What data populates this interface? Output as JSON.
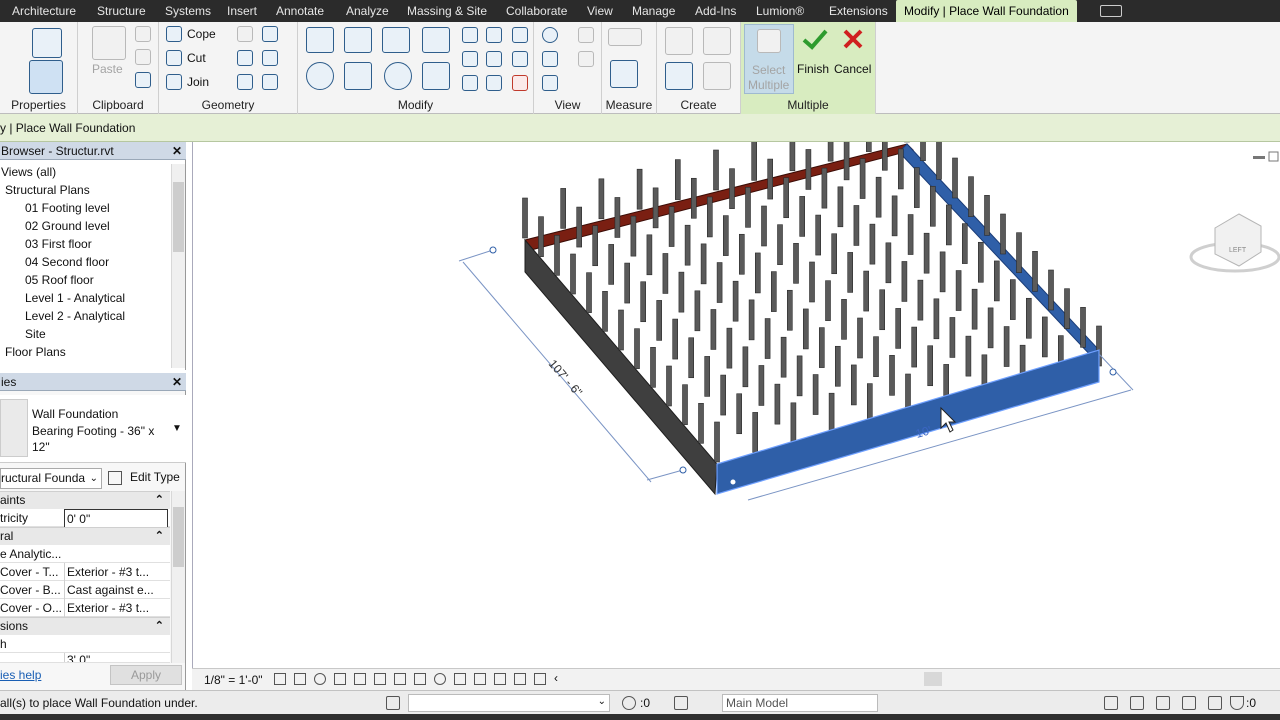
{
  "ribbon_tabs": [
    "Architecture",
    "Structure",
    "Systems",
    "Insert",
    "Annotate",
    "Analyze",
    "Massing & Site",
    "Collaborate",
    "View",
    "Manage",
    "Add-Ins",
    "Lumion®",
    "Extensions",
    "Modify | Place Wall Foundation"
  ],
  "ribbon": {
    "panels": {
      "properties": "Properties",
      "clipboard": "Clipboard",
      "geometry": "Geometry",
      "modify": "Modify",
      "view": "View",
      "measure": "Measure",
      "create": "Create",
      "multiple": "Multiple"
    },
    "paste": "Paste",
    "cope": "Cope",
    "cut": "Cut",
    "join": "Join",
    "select_multiple_1": "Select",
    "select_multiple_2": "Multiple",
    "finish": "Finish",
    "cancel": "Cancel"
  },
  "options_bar": {
    "label": "y | Place Wall Foundation"
  },
  "project_browser": {
    "title": "Browser - Structur.rvt",
    "items": [
      "Views (all)",
      "Structural Plans",
      "01 Footing level",
      "02 Ground level",
      "03 First floor",
      "04 Second floor",
      "05 Roof floor",
      "Level 1 - Analytical",
      "Level 2 - Analytical",
      "Site",
      "Floor Plans"
    ]
  },
  "properties": {
    "title": "ies",
    "family": "Wall Foundation",
    "type_line1": "Bearing Footing - 36\" x",
    "type_line2": "12\"",
    "category_select": "ructural Founda",
    "edit_type": "Edit Type",
    "groups": {
      "constraints": "aints",
      "structural": "ral",
      "dimensions": "sions"
    },
    "rows": [
      {
        "key": "tricity",
        "value": "0'  0\""
      },
      {
        "key": "e Analytic...",
        "value": ""
      },
      {
        "key": "Cover - T...",
        "value": "Exterior - #3 t..."
      },
      {
        "key": "Cover - B...",
        "value": "Cast against e..."
      },
      {
        "key": "Cover - O...",
        "value": "Exterior - #3 t..."
      },
      {
        "key": "h",
        "value": ""
      },
      {
        "key": "",
        "value": "3'  0\""
      }
    ],
    "help_link": "ies help",
    "apply": "Apply"
  },
  "canvas": {
    "dim_left": "107' - 6\"",
    "dim_bottom": "10'",
    "viewcube_face": "LEFT"
  },
  "view_control": {
    "scale": "1/8\" = 1'-0\""
  },
  "status": {
    "message": "all(s) to place Wall Foundation under.",
    "worksets": ":0",
    "model": "Main Model",
    "filter_count": ":0"
  },
  "colors": {
    "ribbon_active": "#d8ecc0",
    "selection_blue": "#2f5fa8",
    "wall_red": "#7a1f12",
    "column": "#5a5a5a"
  }
}
